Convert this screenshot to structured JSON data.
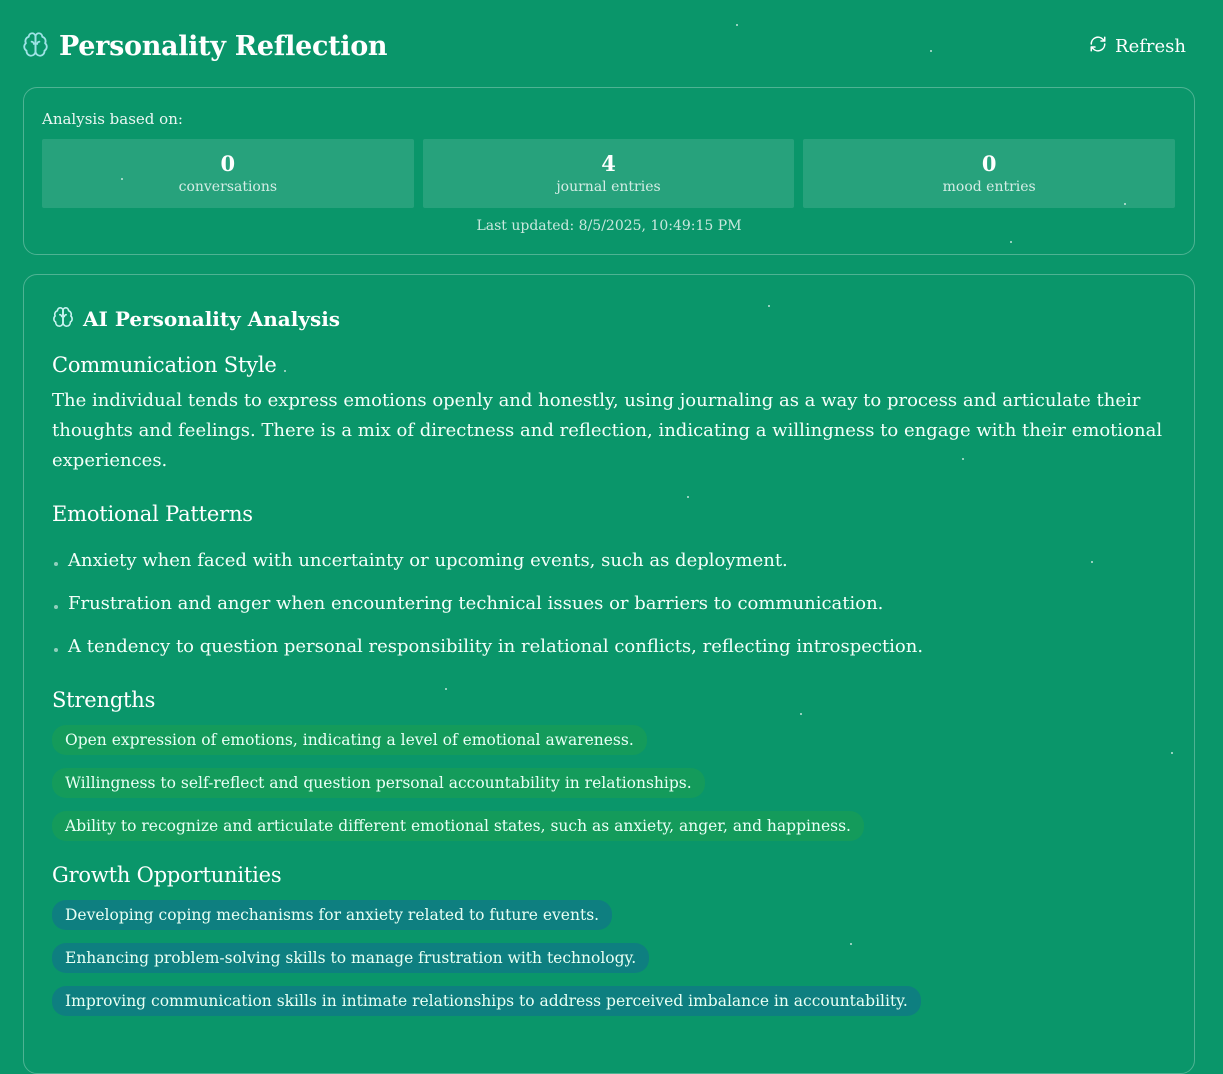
{
  "header": {
    "title": "Personality Reflection",
    "refresh_label": "Refresh"
  },
  "summary": {
    "label": "Analysis based on:",
    "stats": [
      {
        "value": "0",
        "label": "conversations"
      },
      {
        "value": "4",
        "label": "journal entries"
      },
      {
        "value": "0",
        "label": "mood entries"
      }
    ],
    "last_updated": "Last updated: 8/5/2025, 10:49:15 PM"
  },
  "analysis": {
    "heading": "AI Personality Analysis",
    "communication": {
      "title": "Communication Style",
      "text": "The individual tends to express emotions openly and honestly, using journaling as a way to process and articulate their thoughts and feelings. There is a mix of directness and reflection, indicating a willingness to engage with their emotional experiences."
    },
    "emotional": {
      "title": "Emotional Patterns",
      "items": [
        "Anxiety when faced with uncertainty or upcoming events, such as deployment.",
        "Frustration and anger when encountering technical issues or barriers to communication.",
        "A tendency to question personal responsibility in relational conflicts, reflecting introspection."
      ]
    },
    "strengths": {
      "title": "Strengths",
      "items": [
        "Open expression of emotions, indicating a level of emotional awareness.",
        "Willingness to self-reflect and question personal accountability in relationships.",
        "Ability to recognize and articulate different emotional states, such as anxiety, anger, and happiness."
      ]
    },
    "growth": {
      "title": "Growth Opportunities",
      "items": [
        "Developing coping mechanisms for anxiety related to future events.",
        "Enhancing problem-solving skills to manage frustration with technology.",
        "Improving communication skills in intimate relationships to address perceived imbalance in accountability."
      ]
    }
  },
  "icons": {
    "title_icon": "brain-icon",
    "refresh_icon": "refresh-icon",
    "analysis_icon": "brain-icon"
  },
  "colors": {
    "background": "#0a966a",
    "strength_pill": "#149b5b",
    "growth_pill": "#0e7f80"
  }
}
